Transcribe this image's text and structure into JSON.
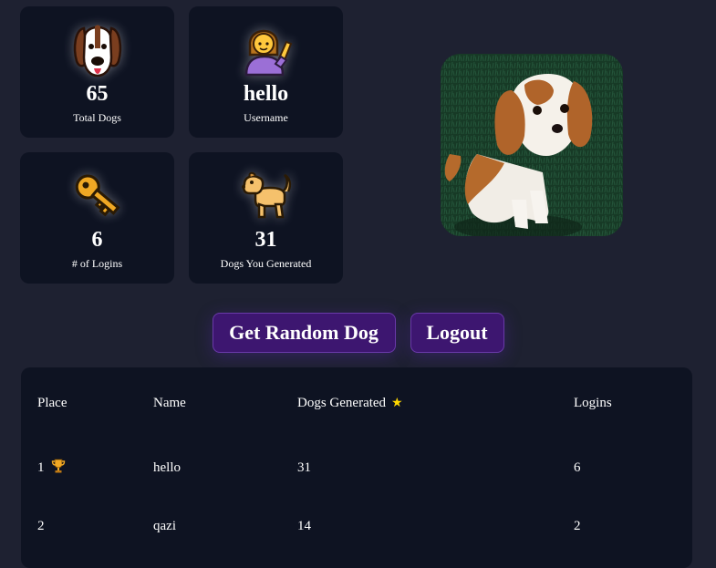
{
  "stats": [
    {
      "icon": "hound-dog-face-icon",
      "value": "65",
      "label": "Total Dogs"
    },
    {
      "icon": "woman-tipping-hand-icon",
      "value": "hello",
      "label": "Username"
    },
    {
      "icon": "key-icon",
      "value": "6",
      "label": "# of Logins"
    },
    {
      "icon": "dog-icon",
      "value": "31",
      "label": "Dogs You Generated"
    }
  ],
  "photo": {
    "alt": "Random dog photo"
  },
  "buttons": {
    "random": "Get Random Dog",
    "logout": "Logout"
  },
  "leaderboard": {
    "headers": {
      "place": "Place",
      "name": "Name",
      "dogs": "Dogs Generated",
      "logins": "Logins"
    },
    "rows": [
      {
        "place": "1",
        "name": "hello",
        "dogs": "31",
        "logins": "6",
        "trophy": true
      },
      {
        "place": "2",
        "name": "qazi",
        "dogs": "14",
        "logins": "2",
        "trophy": false
      }
    ]
  },
  "colors": {
    "background": "#1e2131",
    "card": "#0e1322",
    "button": "#3d1670",
    "star": "#ffd800"
  }
}
